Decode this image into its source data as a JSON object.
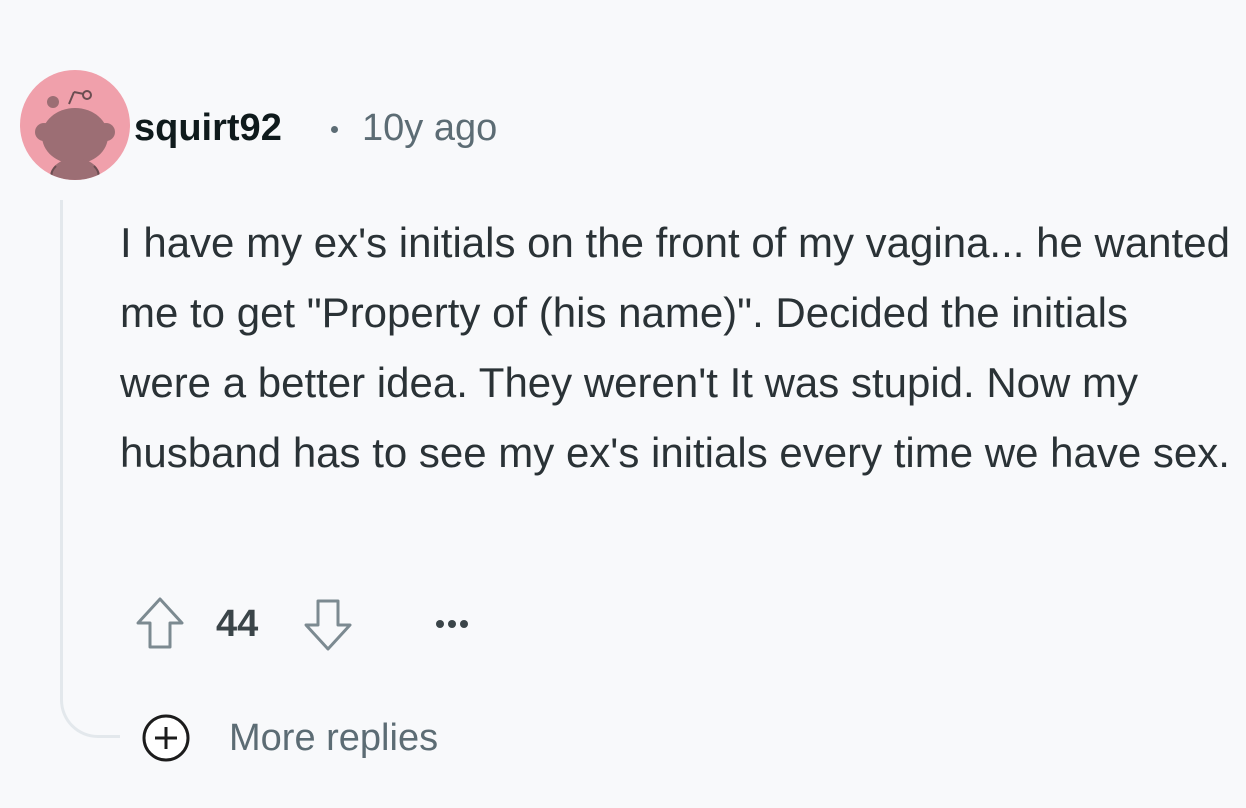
{
  "comment": {
    "author": "squirt92",
    "separator": "•",
    "timestamp": "10y ago",
    "avatar_icon": "snoo-avatar-icon",
    "avatar_color": "#f0a0ab",
    "body": "I have my ex's initials on the front of my vagina... he wanted me to get \"Property of (his name)\". Decided the initials were a better idea. They weren't It was stupid. Now my husband has to see my ex's initials every time we have sex."
  },
  "actions": {
    "upvote_icon": "upvote-arrow-icon",
    "score": "44",
    "downvote_icon": "downvote-arrow-icon",
    "overflow_icon": "ellipsis-icon"
  },
  "thread": {
    "more_replies_icon": "plus-circle-icon",
    "more_replies_label": "More replies"
  }
}
